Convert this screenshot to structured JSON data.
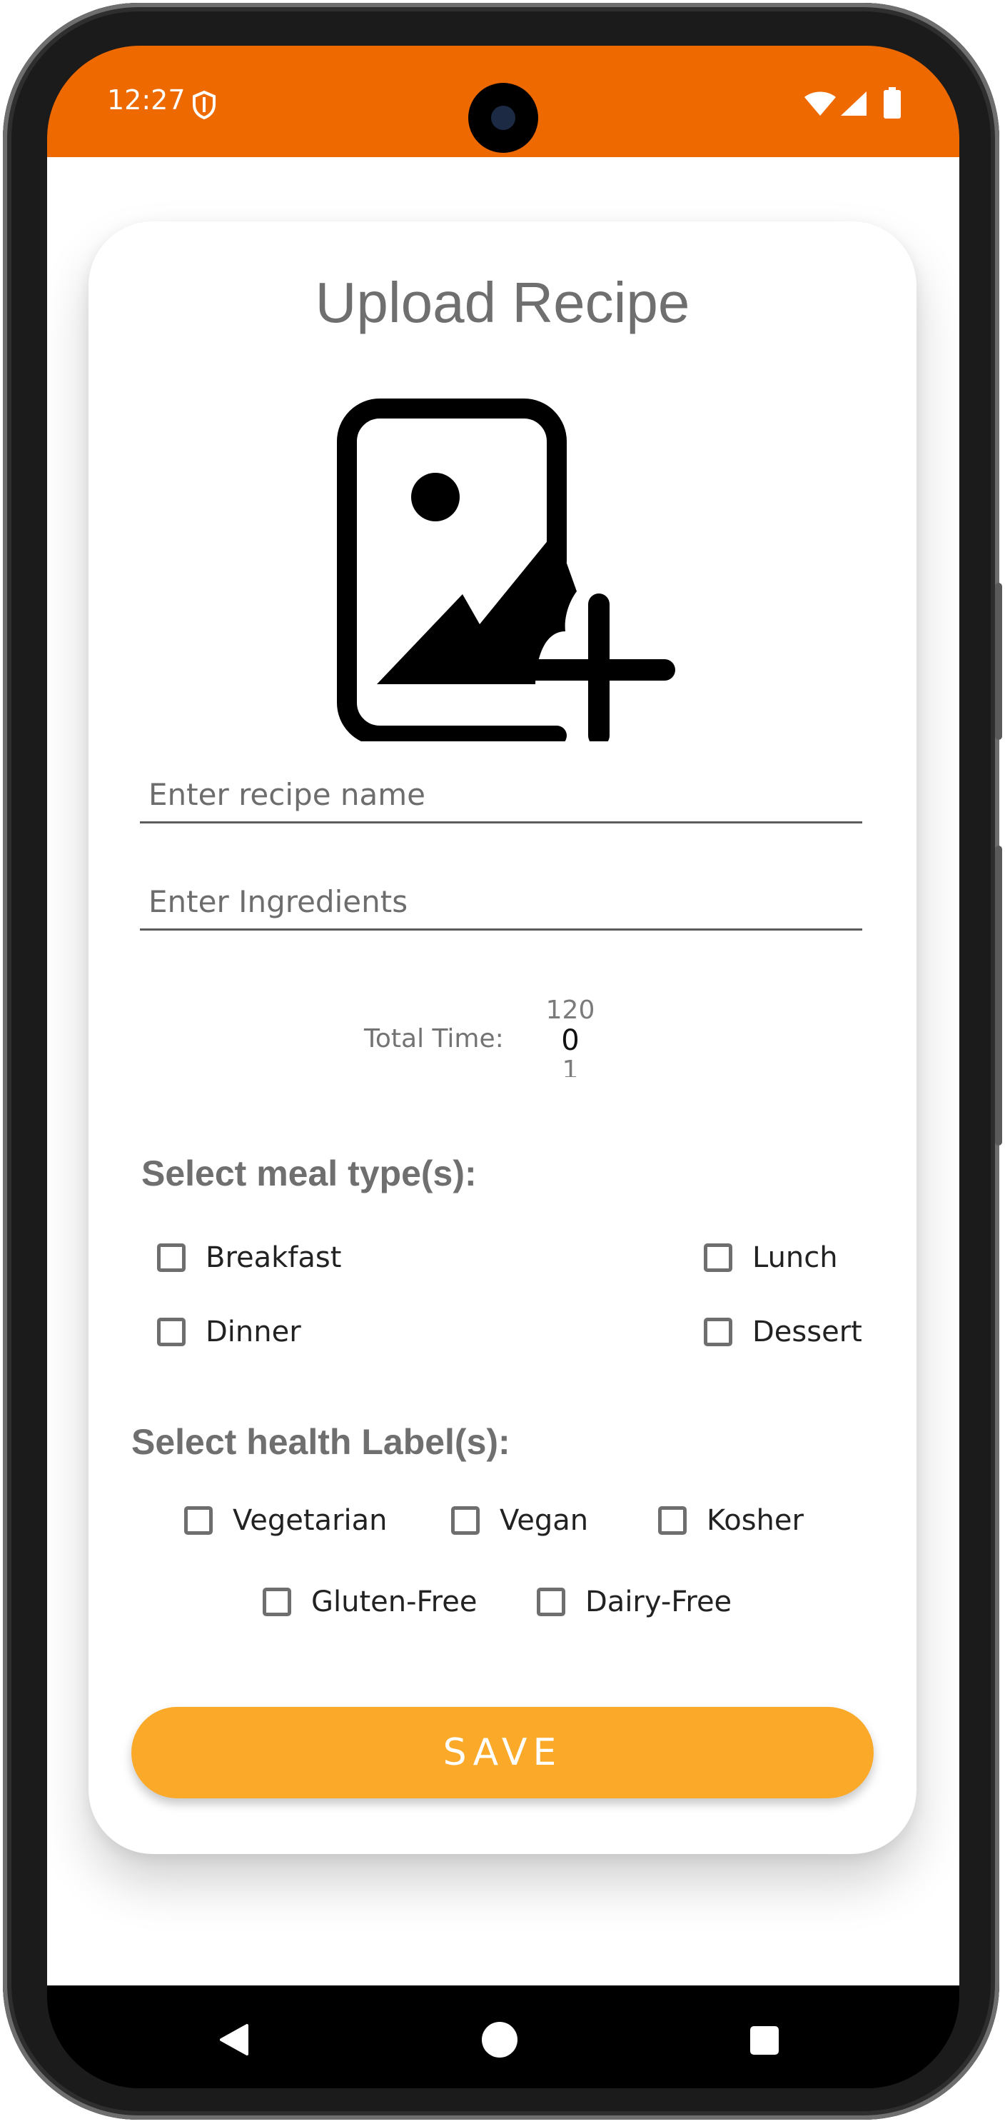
{
  "status_bar": {
    "time": "12:27",
    "shield_icon": "shield-icon",
    "wifi_icon": "wifi-icon",
    "signal_icon": "signal-icon",
    "battery_icon": "battery-icon",
    "color": "#ee6a00"
  },
  "form": {
    "title": "Upload Recipe",
    "image_button_icon": "add-photo-icon",
    "recipe_name_placeholder": "Enter recipe name",
    "ingredients_placeholder": "Enter Ingredients",
    "total_time_label": "Total Time:",
    "time_picker": {
      "previous": "120",
      "current": "0",
      "next": "1"
    },
    "meal_section_title": "Select meal type(s):",
    "meal_types": [
      "Breakfast",
      "Lunch",
      "Dinner",
      "Dessert"
    ],
    "health_section_title": "Select health Label(s):",
    "health_labels": [
      "Vegetarian",
      "Vegan",
      "Kosher",
      "Gluten-Free",
      "Dairy-Free"
    ],
    "save_label": "SAVE",
    "save_color": "#fba929"
  },
  "nav_bar": {
    "back_icon": "back-triangle-icon",
    "home_icon": "home-circle-icon",
    "recents_icon": "recents-square-icon"
  }
}
